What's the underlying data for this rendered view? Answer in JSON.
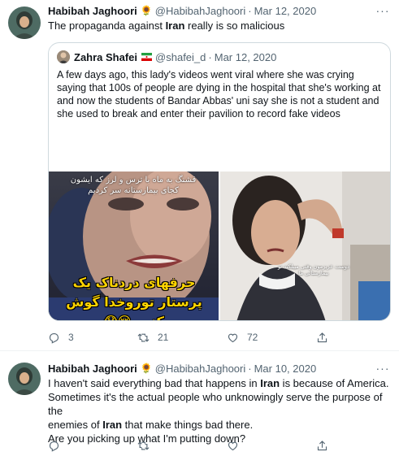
{
  "tweets": [
    {
      "author_name": "Habibah Jaghoori",
      "author_emoji": "🌻",
      "author_handle": "@HabibahJaghoori",
      "separator": "·",
      "date": "Mar 12, 2020",
      "text_before": "The propaganda against ",
      "text_bold": "Iran",
      "text_after": " really is so malicious",
      "quote": {
        "author_name": "Zahra Shafei",
        "author_handle": "@shafei_d",
        "separator": "·",
        "date": "Mar 12, 2020",
        "text": "A few days ago, this lady's videos went viral where she was crying saying that 100s of people are dying in the hospital that she's working at and now the students of Bandar Abbas' uni say she is not a student and she used to break and enter their pavilion to record fake videos",
        "media_left_top_text": "قشنگ به ماه با ترس و لرز که ایشون کجای بیمارستانه سر کردیم",
        "media_left_bottom_text": "حرفهای دردناک یک پرستار تورو‌خدا گوش کنیم 😔😱",
        "media_right_text": "دوست عزیزمون وقتی میبلکید تو بیمارستانی ما"
      },
      "actions": {
        "reply_count": "3",
        "retweet_count": "21",
        "like_count": "72"
      }
    },
    {
      "author_name": "Habibah Jaghoori",
      "author_emoji": "🌻",
      "author_handle": "@HabibahJaghoori",
      "separator": "·",
      "date": "Mar 10, 2020",
      "line1_before": "I haven't said everything bad that happens in ",
      "line1_bold": "Iran",
      "line1_after": " is because of America.",
      "line2": "Sometimes it's the actual people who unknowingly serve the purpose of the",
      "line3_before": "enemies of ",
      "line3_bold": "Iran",
      "line3_after": " that make things bad there.",
      "line4": "Are you picking up what I'm putting down?"
    }
  ],
  "more_icon_text": "···",
  "colors": {
    "text": "#0f1419",
    "secondary": "#536471",
    "border": "#cfd9de",
    "divider": "#eff3f4"
  },
  "icons": [
    "more-icon",
    "reply-icon",
    "retweet-icon",
    "like-icon",
    "share-icon",
    "iran-flag-icon"
  ]
}
